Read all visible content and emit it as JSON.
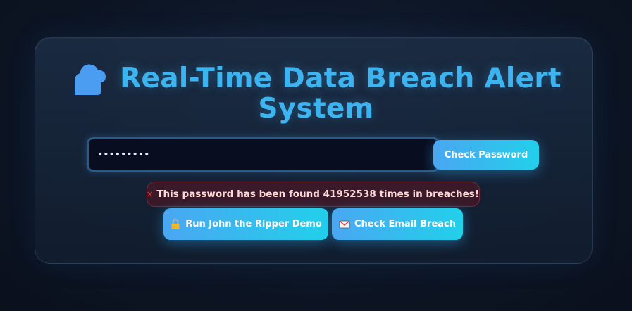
{
  "header": {
    "icon": "cloud-icon",
    "title_line1": "Real-Time Data Breach Alert",
    "title_line2": "System"
  },
  "password_form": {
    "value": "•••••••••",
    "check_button_label": "Check Password"
  },
  "alert": {
    "icon": "x-icon",
    "message": "This password has been found 41952538 times in breaches!"
  },
  "actions": {
    "john_label": "Run John the Ripper Demo",
    "john_icon": "lock-icon",
    "email_label": "Check Email Breach",
    "email_icon": "mail-icon"
  },
  "colors": {
    "accent": "#3db4f0",
    "button_gradient_start": "#4aa7f2",
    "button_gradient_end": "#22d0ea",
    "alert_bg": "#5a141e",
    "alert_text": "#ffd9d9",
    "alert_icon": "#e0322e"
  }
}
